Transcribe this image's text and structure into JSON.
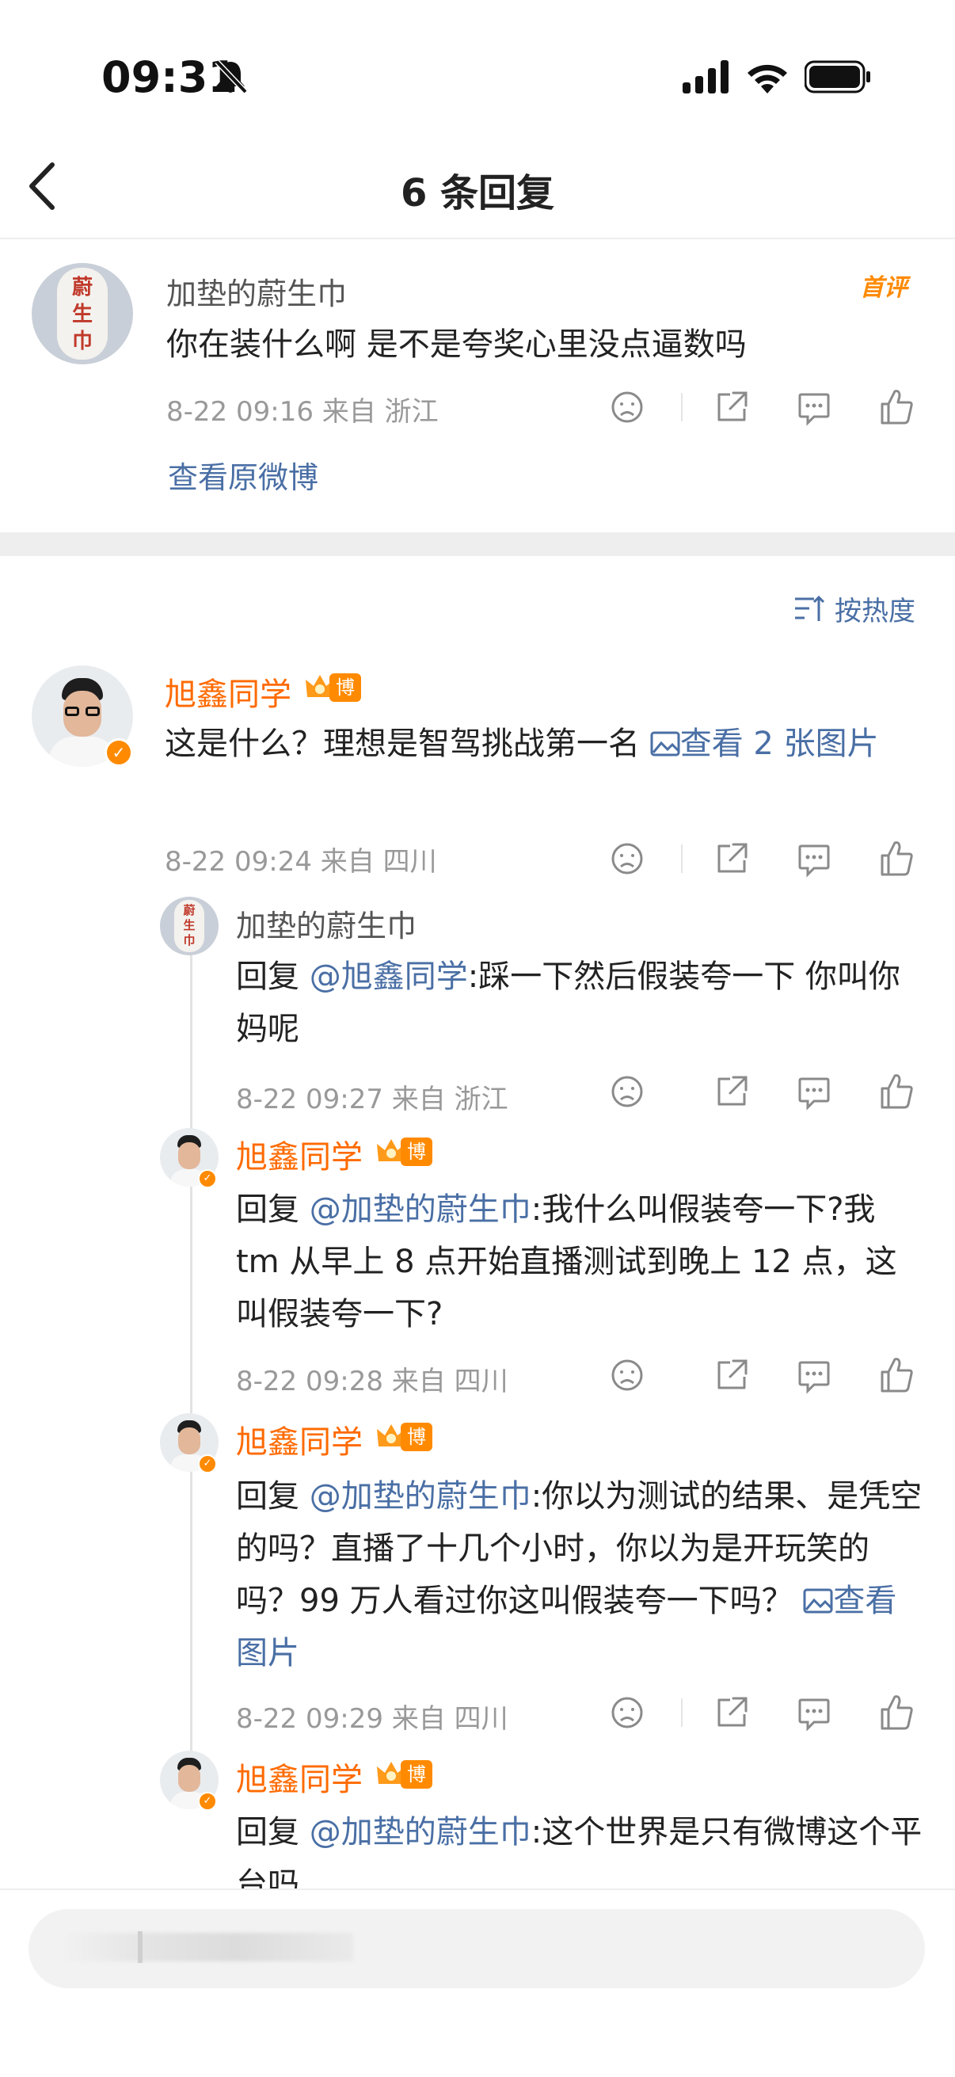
{
  "status_bar": {
    "time": "09:31"
  },
  "nav": {
    "title": "6 条回复"
  },
  "root_comment": {
    "avatar_text": [
      "蔚",
      "生",
      "巾"
    ],
    "username": "加垫的蔚生巾",
    "tag": "首评",
    "text": "你在装什么啊 是不是夸奖心里没点逼数吗",
    "meta": "8-22 09:16  来自 浙江",
    "view_original": "查看原微博"
  },
  "sort": {
    "label": "按热度"
  },
  "badge_label": "博主",
  "replies": [
    {
      "username": "旭鑫同学",
      "text_plain": "这是什么？理想是智驾挑战第一名 ",
      "link": "查看 2 张图片",
      "meta": "8-22 09:24  来自 四川"
    },
    {
      "username": "加垫的蔚生巾",
      "reply_prefix": "回复 ",
      "mention": "@旭鑫同学",
      "text": ":踩一下然后假装夸一下 你叫你妈呢",
      "meta": "8-22 09:27  来自 浙江"
    },
    {
      "username": "旭鑫同学",
      "reply_prefix": "回复 ",
      "mention": "@加垫的蔚生巾",
      "text": ":我什么叫假装夸一下?我 tm 从早上 8 点开始直播测试到晚上 12 点，这叫假装夸一下?",
      "meta": "8-22 09:28  来自 四川"
    },
    {
      "username": "旭鑫同学",
      "reply_prefix": "回复 ",
      "mention": "@加垫的蔚生巾",
      "text": ":你以为测试的结果、是凭空的吗？直播了十几个小时，你以为是开玩笑的吗？99 万人看过你这叫假装夸一下吗？  ",
      "link": "查看图片",
      "meta": "8-22 09:29  来自 四川"
    },
    {
      "username": "旭鑫同学",
      "reply_prefix": "回复 ",
      "mention": "@加垫的蔚生巾",
      "text": ":这个世界是只有微博这个平台吗"
    }
  ],
  "colors": {
    "orange": "#ff6a00",
    "link": "#4a6fa5",
    "badge": "#ff8a00",
    "meta": "#999999"
  }
}
